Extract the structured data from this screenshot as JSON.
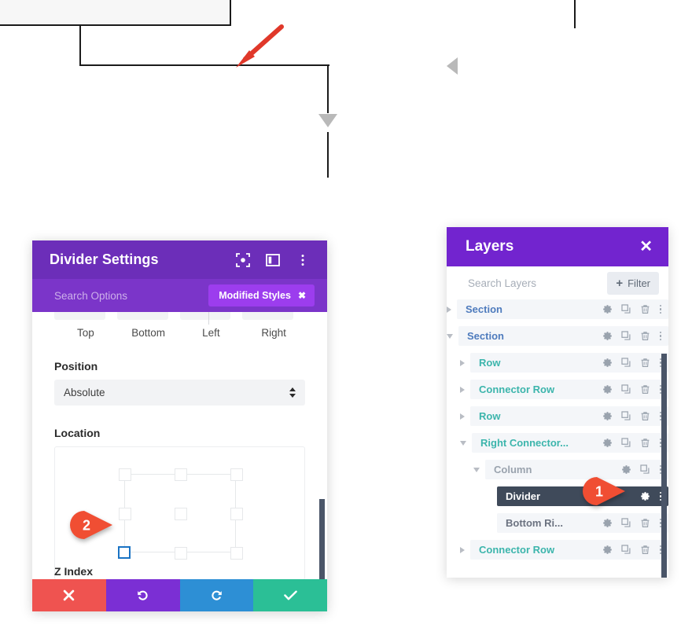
{
  "wireframe": {
    "red_arrow_color": "#e0382a",
    "triangle_color": "#b9b9b9",
    "line_color": "#1b1b1b"
  },
  "modal": {
    "title": "Divider Settings",
    "header_icons": [
      "focus-target-icon",
      "panel-layout-icon",
      "vertical-dots-icon"
    ],
    "search_placeholder": "Search Options",
    "modified_badge": {
      "label": "Modified Styles",
      "close": "✖"
    },
    "quad_labels": [
      "Top",
      "Bottom",
      "Left",
      "Right"
    ],
    "position": {
      "label": "Position",
      "value": "Absolute"
    },
    "location": {
      "label": "Location",
      "selected_cell": "bottom-left"
    },
    "zindex_label": "Z Index",
    "footer": [
      {
        "name": "cancel",
        "icon": "✖",
        "color": "#ef5350"
      },
      {
        "name": "undo",
        "icon": "↺",
        "color": "#7b2fd4"
      },
      {
        "name": "redo",
        "icon": "↻",
        "color": "#2d8fd5"
      },
      {
        "name": "save",
        "icon": "✔",
        "color": "#2bbf96"
      }
    ]
  },
  "layers": {
    "title": "Layers",
    "close_icon": "✕",
    "search_placeholder": "Search Layers",
    "filter_button": {
      "plus": "+",
      "label": "Filter"
    },
    "rows": [
      {
        "label": "Section",
        "type": "section",
        "indent": 0,
        "caret": "right",
        "actions": [
          "gear",
          "duplicate",
          "trash",
          "dots"
        ],
        "selected": false
      },
      {
        "label": "Section",
        "type": "section",
        "indent": 0,
        "caret": "down",
        "actions": [
          "gear",
          "duplicate",
          "trash",
          "dots"
        ],
        "selected": false
      },
      {
        "label": "Row",
        "type": "row",
        "indent": 1,
        "caret": "right",
        "actions": [
          "gear",
          "duplicate",
          "trash",
          "dots"
        ],
        "selected": false
      },
      {
        "label": "Connector Row",
        "type": "row",
        "indent": 1,
        "caret": "right",
        "actions": [
          "gear",
          "duplicate",
          "trash",
          "dots"
        ],
        "selected": false
      },
      {
        "label": "Row",
        "type": "row",
        "indent": 1,
        "caret": "right",
        "actions": [
          "gear",
          "duplicate",
          "trash",
          "dots"
        ],
        "selected": false
      },
      {
        "label": "Right Connector...",
        "type": "row",
        "indent": 1,
        "caret": "down",
        "actions": [
          "gear",
          "duplicate",
          "trash",
          "dots"
        ],
        "selected": false
      },
      {
        "label": "Column",
        "type": "column",
        "indent": 2,
        "caret": "down",
        "actions": [
          "gear",
          "duplicate",
          "dots"
        ],
        "selected": false
      },
      {
        "label": "Divider",
        "type": "module",
        "indent": 3,
        "caret": "none",
        "actions": [
          "gear",
          "dots"
        ],
        "selected": true
      },
      {
        "label": "Bottom Ri...",
        "type": "module",
        "indent": 3,
        "caret": "none",
        "actions": [
          "gear",
          "duplicate",
          "trash",
          "dots"
        ],
        "selected": false
      },
      {
        "label": "Connector Row",
        "type": "row",
        "indent": 1,
        "caret": "right",
        "actions": [
          "gear",
          "duplicate",
          "trash",
          "dots"
        ],
        "selected": false
      }
    ]
  },
  "callouts": [
    {
      "number": "1",
      "color": "#f04e33"
    },
    {
      "number": "2",
      "color": "#f04e33"
    }
  ]
}
